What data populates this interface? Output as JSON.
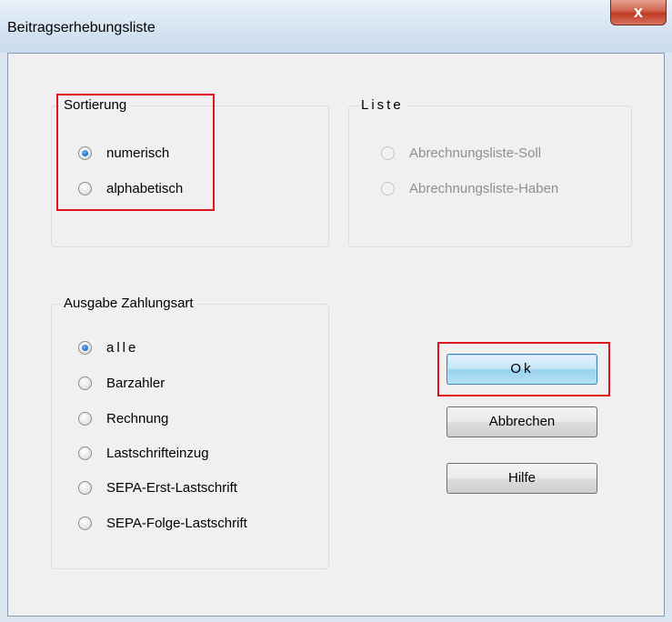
{
  "window": {
    "title": "Beitragserhebungsliste",
    "close_glyph": "x",
    "close_icon": "close-icon"
  },
  "sortierung": {
    "legend": "Sortierung",
    "options": [
      {
        "label": "numerisch",
        "checked": true
      },
      {
        "label": "alphabetisch",
        "checked": false
      }
    ]
  },
  "liste": {
    "legend": "Liste",
    "enabled": false,
    "options": [
      {
        "label": "Abrechnungsliste-Soll",
        "checked": false
      },
      {
        "label": "Abrechnungsliste-Haben",
        "checked": false
      }
    ]
  },
  "zahlungsart": {
    "legend": "Ausgabe Zahlungsart",
    "options": [
      {
        "label": "alle",
        "checked": true
      },
      {
        "label": "Barzahler",
        "checked": false
      },
      {
        "label": "Rechnung",
        "checked": false
      },
      {
        "label": "Lastschrifteinzug",
        "checked": false
      },
      {
        "label": "SEPA-Erst-Lastschrift",
        "checked": false
      },
      {
        "label": "SEPA-Folge-Lastschrift",
        "checked": false
      }
    ]
  },
  "buttons": {
    "ok": "Ok",
    "cancel": "Abbrechen",
    "help": "Hilfe"
  },
  "colors": {
    "highlight": "#e0141e",
    "radio_checked": "#1c6fc2"
  }
}
